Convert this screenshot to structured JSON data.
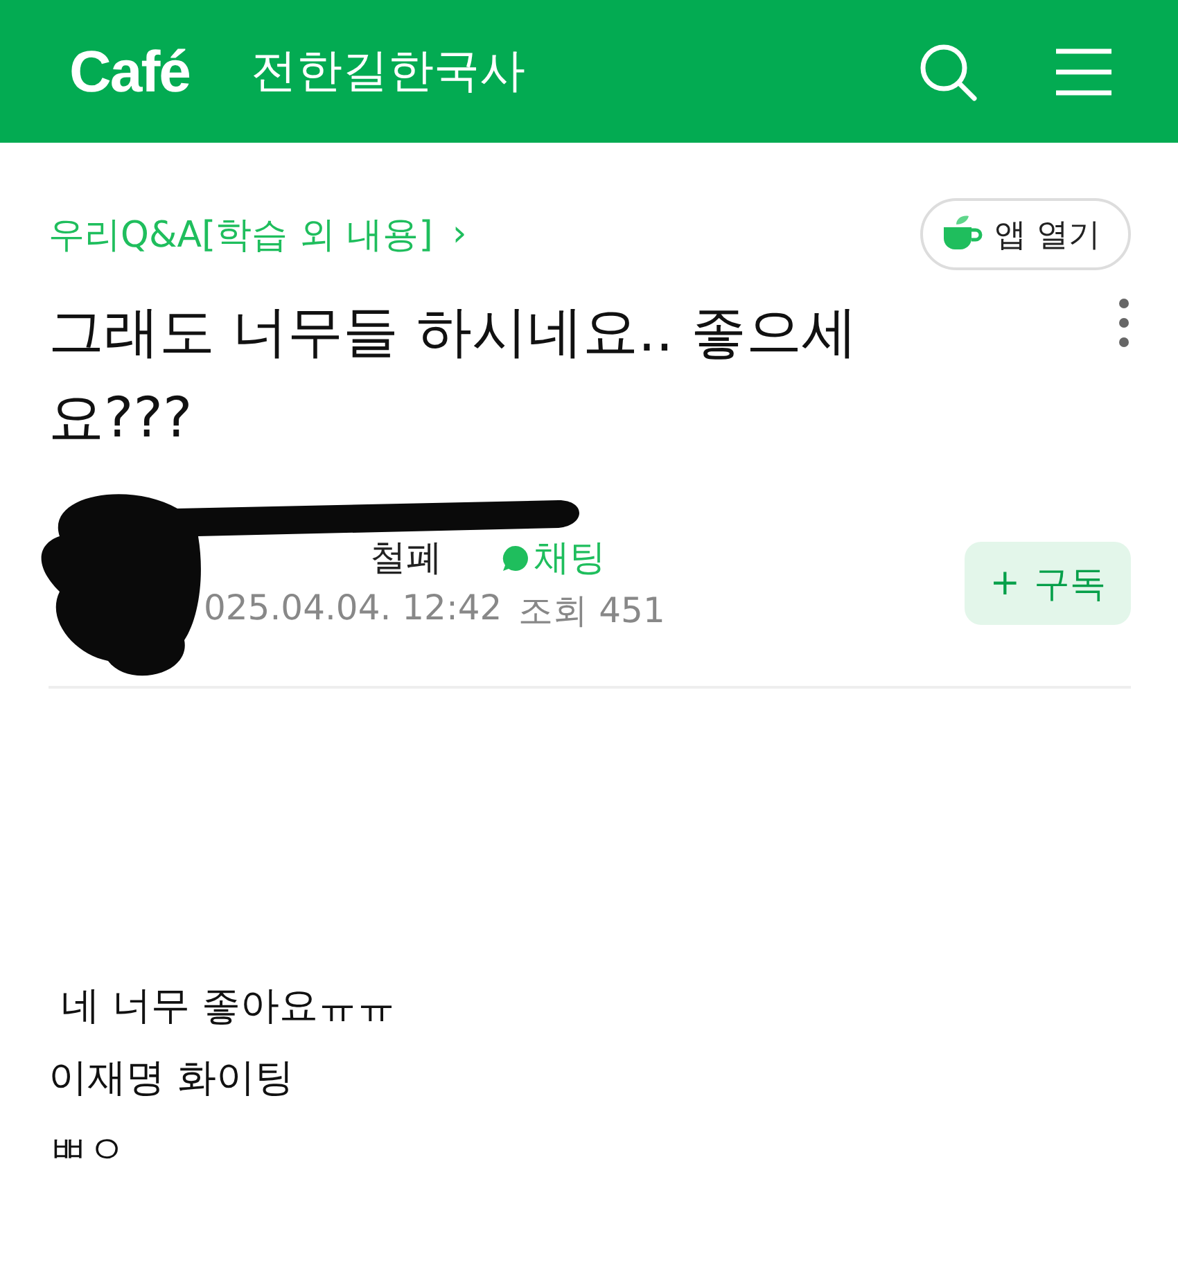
{
  "header": {
    "logo": "Café",
    "cafe_name": "전한길한국사"
  },
  "post": {
    "board": "우리Q&A[학습 외 내용]",
    "board_arrow": "›",
    "app_button": "앱 열기",
    "title": "그래도 너무들 하시네요.. 좋으세요???",
    "author": {
      "name": "철폐",
      "chat": "채팅",
      "date": "025.04.04. 12:42",
      "views": "조회 451",
      "subscribe": "구독",
      "subscribe_icon": "+"
    },
    "body": [
      " 네 너무 좋아요ㅠㅠ",
      "이재명 화이팅",
      "ㅃㅇ"
    ]
  }
}
